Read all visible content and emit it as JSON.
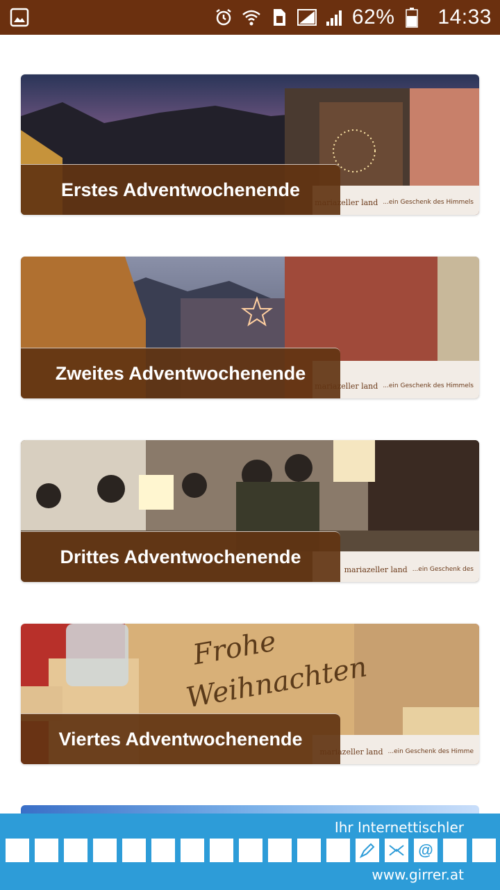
{
  "status_bar": {
    "battery": "62%",
    "time": "14:33",
    "icons": [
      "image-icon",
      "alarm-icon",
      "wifi-icon",
      "sim-icon",
      "signal-icon",
      "battery-icon"
    ]
  },
  "cards": [
    {
      "title": "Erstes Adventwochenende",
      "brand": "mariazeller land",
      "tagline": "...ein Geschenk des Himmels"
    },
    {
      "title": "Zweites Adventwochenende",
      "brand": "mariazeller land",
      "tagline": "...ein Geschenk des Himmels"
    },
    {
      "title": "Drittes Adventwochenende",
      "brand": "mariazeller land",
      "tagline": "...ein Geschenk des"
    },
    {
      "title": "Viertes Adventwochenende",
      "brand": "mariazeller land",
      "tagline": "...ein Geschenk des Himme"
    }
  ],
  "ad": {
    "headline": "Ihr Internettischler",
    "url": "www.girrer.at",
    "box_symbol": "@"
  },
  "colors": {
    "statusbar": "#6b300f",
    "label_bg": "#623412",
    "ad_bg": "#2d9cd8"
  }
}
